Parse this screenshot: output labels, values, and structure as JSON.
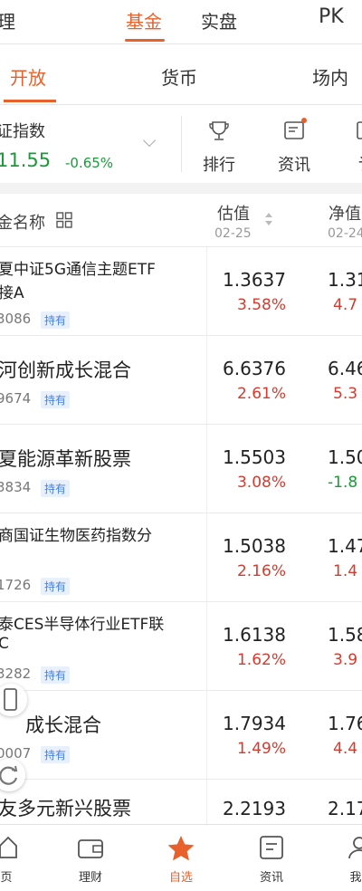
{
  "top_nav": {
    "left_label": "理",
    "fund_label": "基金",
    "firm_label": "实盘",
    "pk_label": "PK"
  },
  "sub_nav": {
    "open_label": "开放",
    "money_label": "货币",
    "floor_label": "场内"
  },
  "index": {
    "name": "证指数",
    "price": "11.55",
    "change": "-0.65%"
  },
  "quick_actions": {
    "rank_label": "排行",
    "news_label": "资讯",
    "more_label": "讠"
  },
  "table": {
    "col_name": "金名称",
    "col_est": "估值",
    "col_est_date": "02-25",
    "col_nav": "净值",
    "col_nav_date": "02-24",
    "hold_label": "持有",
    "rows": [
      {
        "name_line1": "夏中证5G通信主题ETF",
        "name_line2": "接A",
        "code": "3086",
        "est": "1.3637",
        "est_pct": "3.58%",
        "nav": "1.31",
        "nav_pct": "4.7"
      },
      {
        "name": "河创新成长混合",
        "code": "9674",
        "est": "6.6376",
        "est_pct": "2.61%",
        "nav": "6.46",
        "nav_pct": "5.3"
      },
      {
        "name": "夏能源革新股票",
        "code": "3834",
        "est": "1.5503",
        "est_pct": "3.08%",
        "nav": "1.50",
        "nav_pct": "-1.8"
      },
      {
        "name_line1": "商国证生物医药指数分",
        "name_line2": "",
        "code": "1726",
        "est": "1.5038",
        "est_pct": "2.16%",
        "nav": "1.47",
        "nav_pct": "1.4"
      },
      {
        "name_line1": "泰CES半导体行业ETF联",
        "name_line2": "C",
        "code": "3282",
        "est": "1.6138",
        "est_pct": "1.62%",
        "nav": "1.58",
        "nav_pct": "3.9"
      },
      {
        "name": "成长混合",
        "code": "0007",
        "est": "1.7934",
        "est_pct": "1.49%",
        "nav": "1.76",
        "nav_pct": "4.4"
      },
      {
        "name": "友多元新兴股票",
        "est": "2.2193",
        "nav": "2.17"
      }
    ]
  },
  "bottom_nav": {
    "home_label": "页",
    "finance_label": "理财",
    "watch_label": "自选",
    "news_label": "资讯",
    "me_label": "我"
  },
  "colors": {
    "accent": "#e8612c",
    "up": "#d63a2e",
    "down": "#1a9a3a"
  }
}
